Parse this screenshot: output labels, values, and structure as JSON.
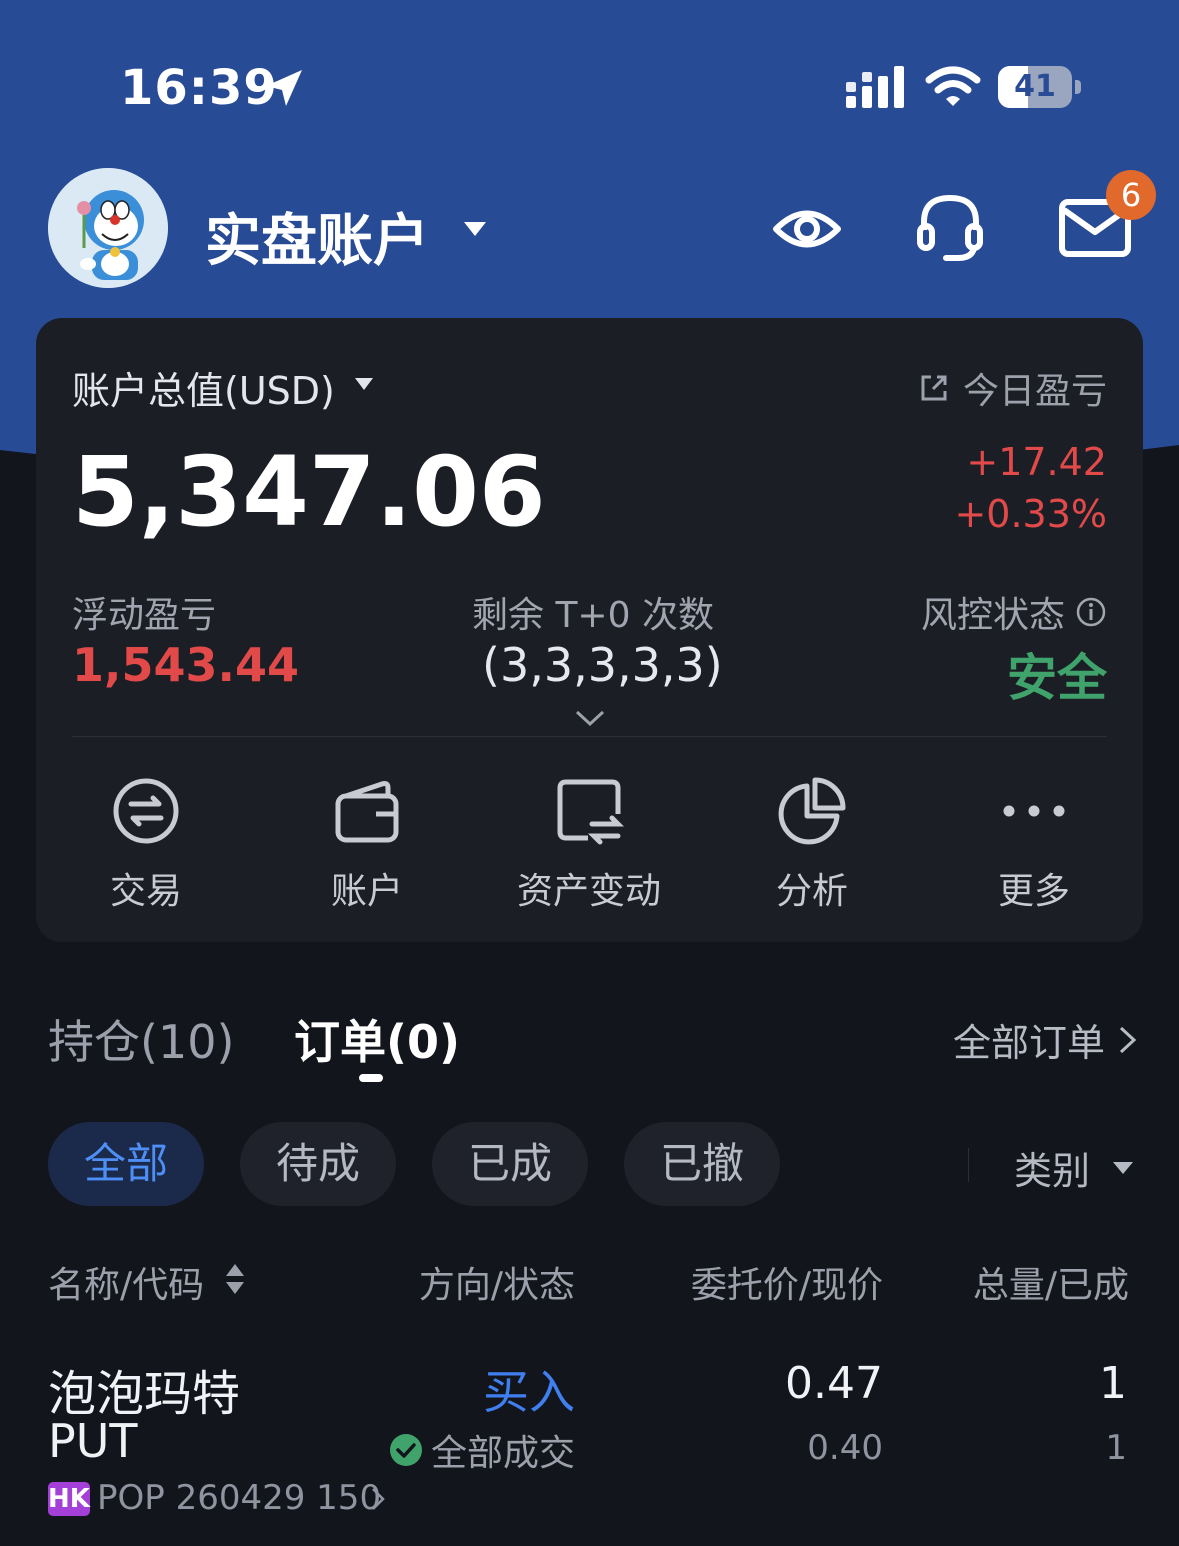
{
  "colors": {
    "header_blue": "#284b96",
    "background": "#13151c",
    "card": "#1c1e26",
    "up_red": "#e24a4a",
    "safe_green": "#3fa36b",
    "accent_blue": "#3f7ff0",
    "hk_badge": "#a43fd7",
    "notification_badge": "#e0692b"
  },
  "status_bar": {
    "time": "16:39",
    "battery_level": "41",
    "battery_fraction": 0.41,
    "icons": [
      "location-arrow-icon",
      "cellular-signal-icon",
      "wifi-icon",
      "battery-icon"
    ]
  },
  "header": {
    "account_title": "实盘账户",
    "icons": [
      "eye-icon",
      "headset-icon",
      "mail-icon"
    ],
    "mail_badge": "6"
  },
  "summary": {
    "total_label": "账户总值(USD)",
    "total_value": "5,347.06",
    "today_label": "今日盈亏",
    "today_change": "+17.42",
    "today_change_pct": "+0.33%",
    "floating_label": "浮动盈亏",
    "floating_value": "1,543.44",
    "t0_label": "剩余 T+0 次数",
    "t0_value": "(3,3,3,3,3)",
    "risk_label": "风控状态",
    "risk_value": "安全"
  },
  "actions": [
    {
      "label": "交易",
      "icon": "exchange-icon"
    },
    {
      "label": "账户",
      "icon": "wallet-icon"
    },
    {
      "label": "资产变动",
      "icon": "asset-transfer-icon"
    },
    {
      "label": "分析",
      "icon": "pie-chart-icon"
    },
    {
      "label": "更多",
      "icon": "more-dots-icon"
    }
  ],
  "tabs": {
    "holdings": "持仓(10)",
    "orders": "订单(0)",
    "active": "orders",
    "all_orders": "全部订单"
  },
  "filters": {
    "chips": [
      "全部",
      "待成",
      "已成",
      "已撤"
    ],
    "active": "全部",
    "category": "类别"
  },
  "table": {
    "columns": [
      "名称/代码",
      "方向/状态",
      "委托价/现价",
      "总量/已成"
    ],
    "rows": [
      {
        "name_line1": "泡泡玛特",
        "name_line2": "PUT",
        "market": "HK",
        "code": "POP 260429 150",
        "direction": "买入",
        "status": "全部成交",
        "order_price": "0.47",
        "current_price": "0.40",
        "total_qty": "1",
        "filled_qty": "1"
      }
    ]
  }
}
